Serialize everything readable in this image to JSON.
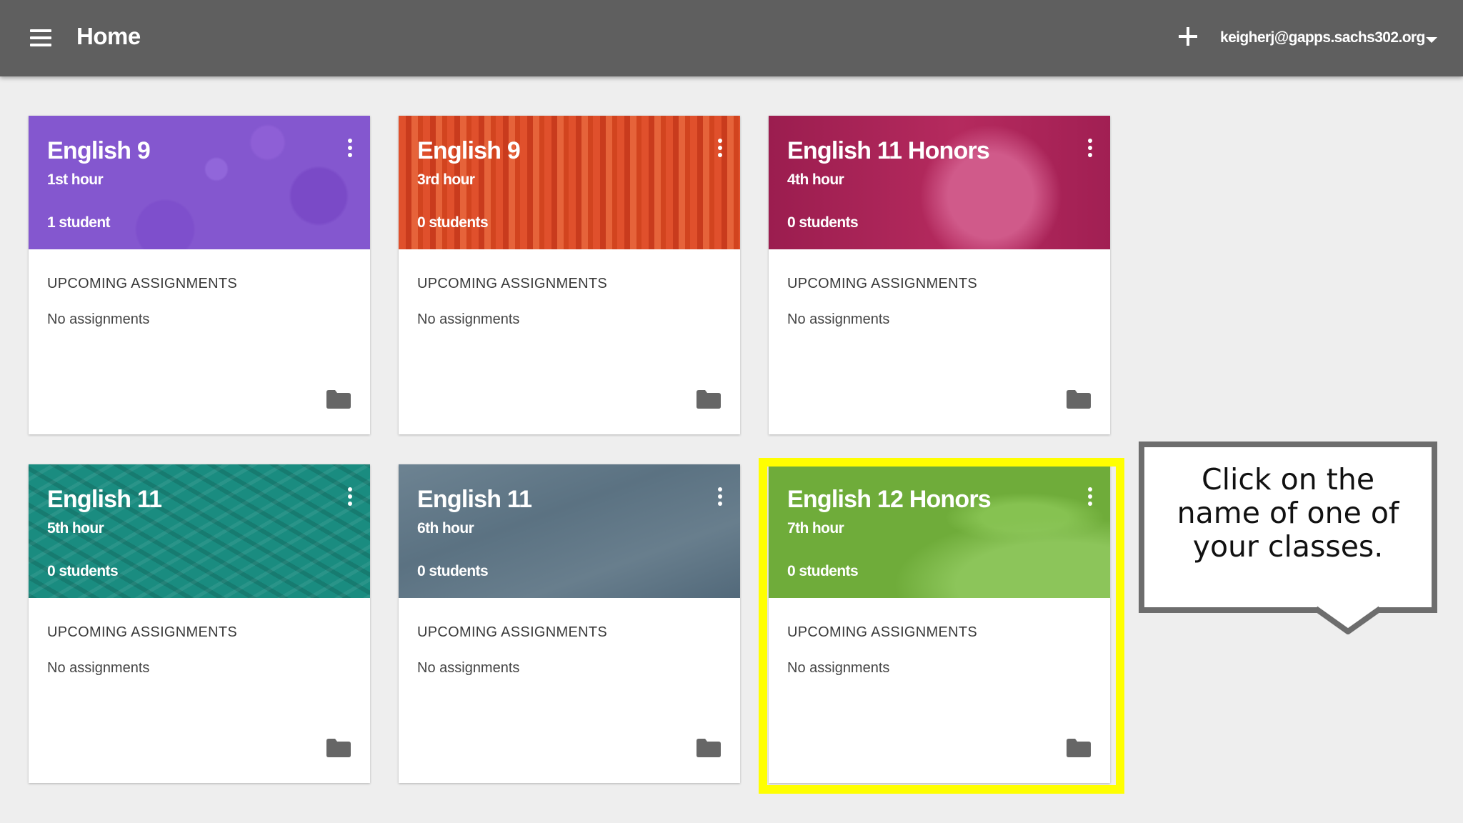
{
  "app": {
    "title": "Home",
    "account_email": "keigherj@gapps.sachs302.org"
  },
  "cards": [
    {
      "title": "English 9",
      "hour": "1st hour",
      "students": "1 student",
      "upcoming_label": "UPCOMING ASSIGNMENTS",
      "assignments": "No assignments",
      "theme": "purple"
    },
    {
      "title": "English 9",
      "hour": "3rd hour",
      "students": "0 students",
      "upcoming_label": "UPCOMING ASSIGNMENTS",
      "assignments": "No assignments",
      "theme": "red"
    },
    {
      "title": "English 11 Honors",
      "hour": "4th hour",
      "students": "0 students",
      "upcoming_label": "UPCOMING ASSIGNMENTS",
      "assignments": "No assignments",
      "theme": "magenta"
    },
    {
      "title": "English 11",
      "hour": "5th hour",
      "students": "0 students",
      "upcoming_label": "UPCOMING ASSIGNMENTS",
      "assignments": "No assignments",
      "theme": "teal"
    },
    {
      "title": "English 11",
      "hour": "6th hour",
      "students": "0 students",
      "upcoming_label": "UPCOMING ASSIGNMENTS",
      "assignments": "No assignments",
      "theme": "slate"
    },
    {
      "title": "English 12 Honors",
      "hour": "7th hour",
      "students": "0 students",
      "upcoming_label": "UPCOMING ASSIGNMENTS",
      "assignments": "No assignments",
      "theme": "green"
    }
  ],
  "callout": {
    "text": "Click on the name of one of your classes."
  },
  "colors": {
    "topbar": "#5f5f5f",
    "highlight": "#ffff00",
    "purple": "#8457cf",
    "red": "#d84a27",
    "magenta": "#a82258",
    "teal": "#1a8c80",
    "slate": "#5f7686",
    "green": "#6fac3a"
  },
  "icons": {
    "menu": "hamburger-menu-icon",
    "add": "plus-icon",
    "dropdown": "caret-down-icon",
    "card_menu": "more-vertical-icon",
    "folder": "folder-icon"
  }
}
